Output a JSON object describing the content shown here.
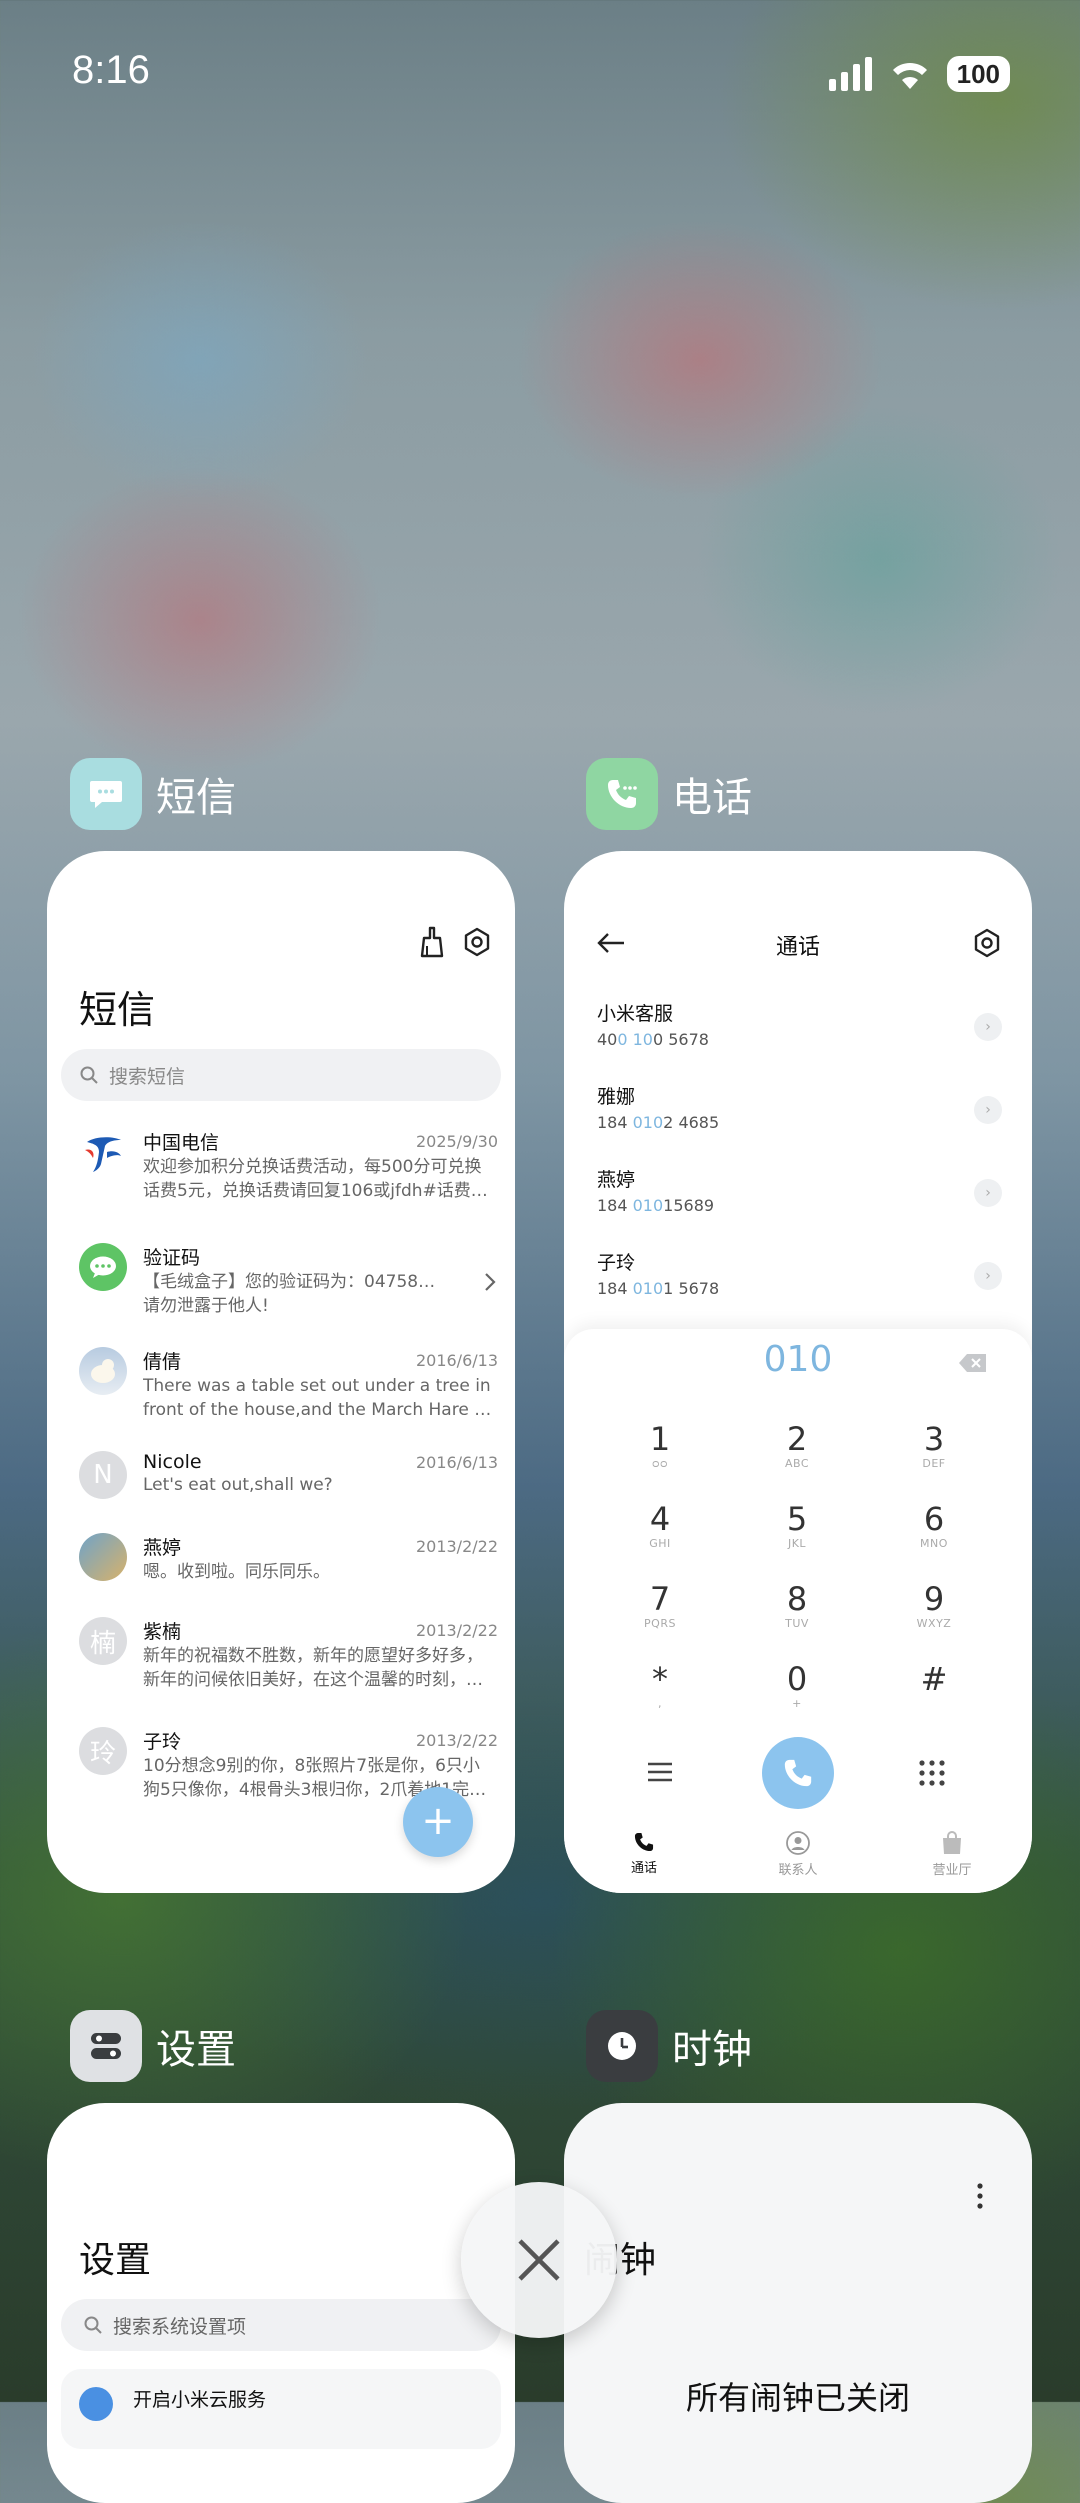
{
  "status_bar": {
    "time": "8:16",
    "battery": "100"
  },
  "apps": {
    "sms": {
      "name": "短信"
    },
    "phone": {
      "name": "电话"
    },
    "settings": {
      "name": "设置"
    },
    "clock": {
      "name": "时钟"
    }
  },
  "sms_card": {
    "title": "短信",
    "search_placeholder": "搜索短信",
    "messages": [
      {
        "sender": "中国电信",
        "date": "2025/9/30",
        "line1": "欢迎参加积分兑换话费活动，每500分可兑换",
        "line2": "话费5元，兑换话费请回复106或jfdh#话费…"
      },
      {
        "sender": "验证码",
        "date": "",
        "line1": "【毛绒盒子】您的验证码为：047588，",
        "line2": "请勿泄露于他人!"
      },
      {
        "sender": "倩倩",
        "date": "2016/6/13",
        "line1": "There was a table set out under a tree in",
        "line2": "front of the house,and the March Hare an…"
      },
      {
        "sender": "Nicole",
        "avatar_letter": "N",
        "date": "2016/6/13",
        "line1": "Let's eat out,shall we?",
        "line2": ""
      },
      {
        "sender": "燕婷",
        "date": "2013/2/22",
        "line1": "嗯。收到啦。同乐同乐。",
        "line2": ""
      },
      {
        "sender": "紫楠",
        "avatar_letter": "楠",
        "date": "2013/2/22",
        "line1": "新年的祝福数不胜数，新年的愿望好多好多，",
        "line2": "新年的问候依旧美好，在这个温馨的时刻，…"
      },
      {
        "sender": "子玲",
        "avatar_letter": "玲",
        "date": "2013/2/22",
        "line1": "10分想念9别的你，8张照片7张是你，6只小",
        "line2": "狗5只像你，4根骨头3根归你，2爪着地1完…"
      }
    ],
    "fab_label": "+"
  },
  "phone_card": {
    "title": "通话",
    "recents": [
      {
        "name": "小米客服",
        "num_pre": "40",
        "num_hl": "0 10",
        "num_post": "0 5678"
      },
      {
        "name": "雅娜",
        "num_pre": "184 ",
        "num_hl": "010",
        "num_post": "2 4685"
      },
      {
        "name": "燕婷",
        "num_pre": "184 ",
        "num_hl": "010",
        "num_post": "15689"
      },
      {
        "name": "子玲",
        "num_pre": "184 ",
        "num_hl": "010",
        "num_post": "1 5678"
      }
    ],
    "dial_input": "010",
    "keys": [
      {
        "d": "1",
        "l": "ᴑᴑ"
      },
      {
        "d": "2",
        "l": "ABC"
      },
      {
        "d": "3",
        "l": "DEF"
      },
      {
        "d": "4",
        "l": "GHI"
      },
      {
        "d": "5",
        "l": "JKL"
      },
      {
        "d": "6",
        "l": "MNO"
      },
      {
        "d": "7",
        "l": "PQRS"
      },
      {
        "d": "8",
        "l": "TUV"
      },
      {
        "d": "9",
        "l": "WXYZ"
      },
      {
        "d": "*",
        "l": ","
      },
      {
        "d": "0",
        "l": "+"
      },
      {
        "d": "#",
        "l": ""
      }
    ],
    "nav": {
      "calls": "通话",
      "contacts": "联系人",
      "store": "营业厅"
    }
  },
  "settings_card": {
    "title": "设置",
    "search_placeholder": "搜索系统设置项",
    "first_item": "开启小米云服务"
  },
  "clock_card": {
    "title": "闹钟",
    "status": "所有闹钟已关闭"
  },
  "colors": {
    "accent_blue": "#7eb6df",
    "fab_blue": "#8cc4ee",
    "sms_icon_bg": "#a9dde0",
    "phone_icon_bg": "#8fd6a2",
    "settings_icon_bg": "#dfe1e4",
    "clock_icon_bg": "#3a3d40"
  }
}
